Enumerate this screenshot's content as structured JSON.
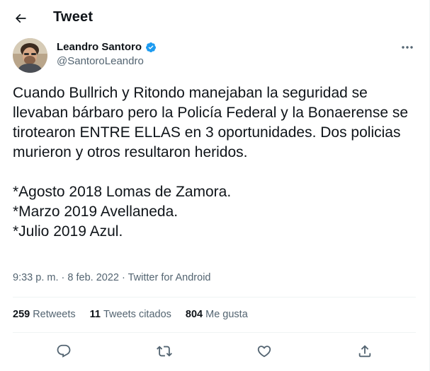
{
  "header": {
    "title": "Tweet",
    "back_icon": "arrow-left-icon"
  },
  "author": {
    "name": "Leandro Santoro",
    "handle": "@SantoroLeandro",
    "verified": true,
    "verified_color": "#1d9bf0"
  },
  "tweet": {
    "text": "Cuando Bullrich y Ritondo manejaban la seguridad se llevaban bárbaro pero la Policía Federal y la Bonaerense se tirotearon ENTRE ELLAS en 3 oportunidades. Dos policias murieron y otros resultaron heridos.\n\n*Agosto 2018 Lomas de Zamora.\n*Marzo 2019 Avellaneda.\n*Julio 2019 Azul.",
    "time": "9:33 p. m.",
    "separator": "·",
    "date": "8 feb. 2022",
    "source": "Twitter for Android"
  },
  "stats": {
    "retweets_count": "259",
    "retweets_label": "Retweets",
    "quotes_count": "11",
    "quotes_label": "Tweets citados",
    "likes_count": "804",
    "likes_label": "Me gusta"
  },
  "actions": [
    {
      "icon": "reply-icon"
    },
    {
      "icon": "retweet-icon"
    },
    {
      "icon": "like-icon"
    },
    {
      "icon": "share-icon"
    }
  ],
  "colors": {
    "text_primary": "#0f1419",
    "text_secondary": "#536471",
    "divider": "#eff3f4",
    "accent": "#1d9bf0"
  }
}
